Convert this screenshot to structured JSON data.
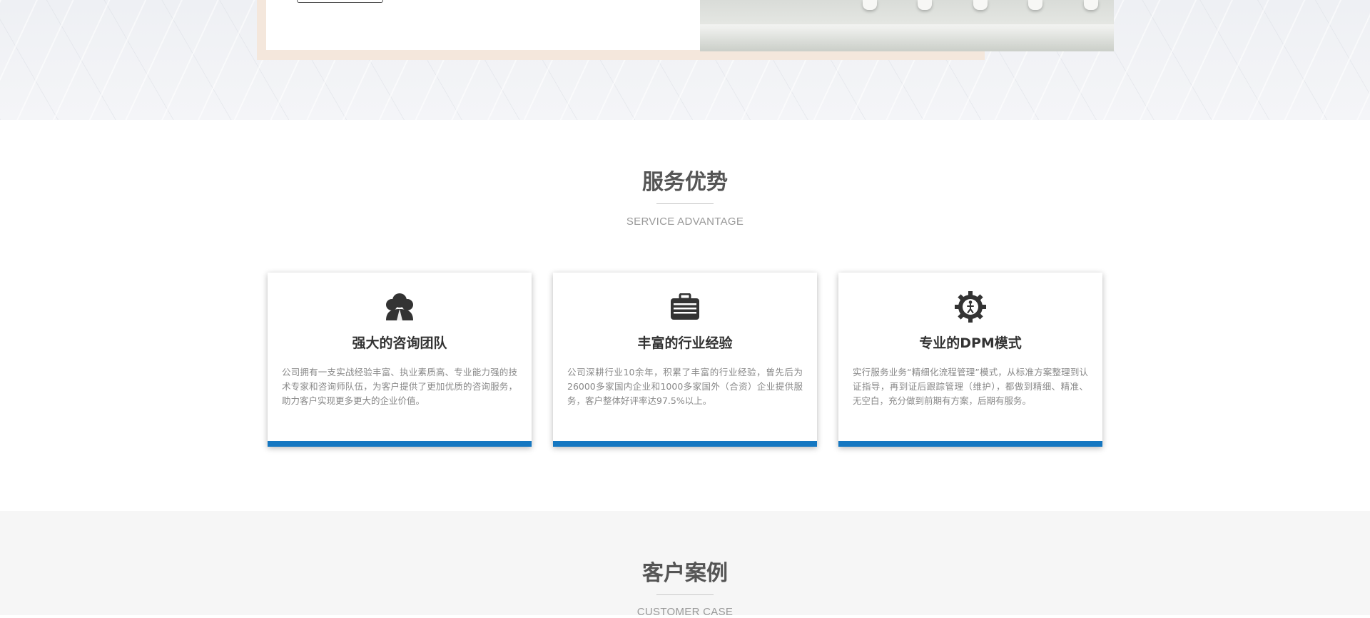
{
  "service": {
    "title": "服务优势",
    "subtitle": "SERVICE ADVANTAGE",
    "cards": [
      {
        "icon": "team-icon",
        "title": "强大的咨询团队",
        "text": "公司拥有一支实战经验丰富、执业素质高、专业能力强的技术专家和咨询师队伍，为客户提供了更加优质的咨询服务，助力客户实现更多更大的企业价值。"
      },
      {
        "icon": "briefcase-icon",
        "title": "丰富的行业经验",
        "text": "公司深耕行业10余年，积累了丰富的行业经验，曾先后为26000多家国内企业和1000多家国外（合资）企业提供服务，客户整体好评率达97.5%以上。"
      },
      {
        "icon": "gear-worker-icon",
        "title": "专业的DPM模式",
        "text": "实行服务业务“精细化流程管理”模式，从标准方案整理到认证指导，再到证后跟踪管理（维护），都做到精细、精准、无空白，充分做到前期有方案，后期有服务。"
      }
    ],
    "accent_color": "#1577c1"
  },
  "cases": {
    "title": "客户案例",
    "subtitle": "CUSTOMER CASE"
  }
}
